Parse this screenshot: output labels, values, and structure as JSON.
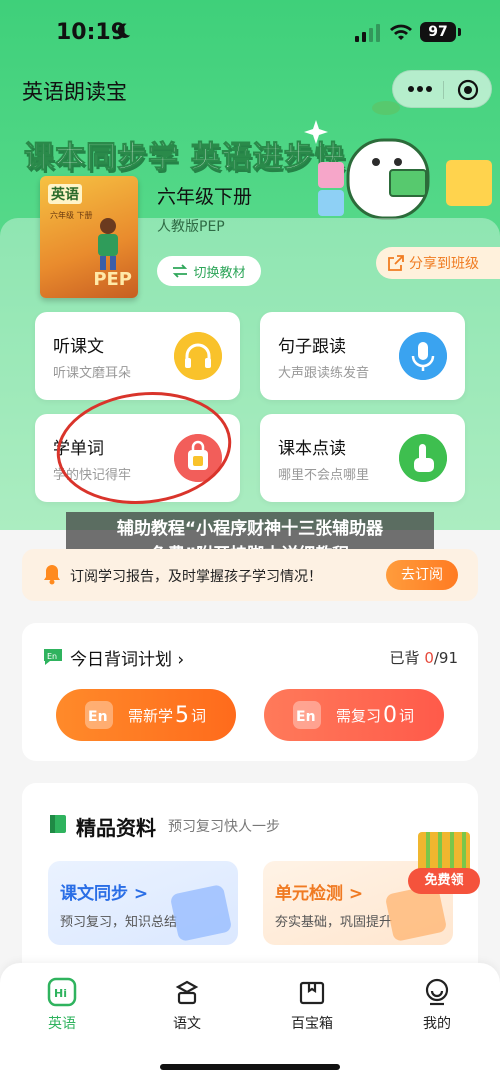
{
  "status": {
    "time": "10:19",
    "battery": "97"
  },
  "header": {
    "app_title": "英语朗读宝"
  },
  "banner": {
    "slogan": "课本同步学 英语进步快"
  },
  "book": {
    "cover_title": "英语",
    "cover_grade": "六年级 下册",
    "cover_logo": "PEP",
    "grade": "六年级下册",
    "edition": "人教版PEP",
    "switch_label": "切换教材",
    "share_label": "分享到班级"
  },
  "features": [
    {
      "title": "听课文",
      "subtitle": "听课文磨耳朵"
    },
    {
      "title": "句子跟读",
      "subtitle": "大声跟读练发音"
    },
    {
      "title": "学单词",
      "subtitle": "学的快记得牢"
    },
    {
      "title": "课本点读",
      "subtitle": "哪里不会点哪里"
    }
  ],
  "watermark": {
    "line1": "辅助教程“小程序财神十三张辅助器",
    "line2": "免费”附开挂脚本详细教程"
  },
  "notice": {
    "text": "订阅学习报告，及时掌握孩子学习情况！",
    "button": "去订阅"
  },
  "plan": {
    "title": "今日背词计划",
    "count_label": "已背",
    "count_done": "0",
    "count_total": "/91",
    "new_prefix": "需新学",
    "new_num": "5",
    "new_unit": "词",
    "review_prefix": "需复习",
    "review_num": "0",
    "review_unit": "词"
  },
  "resources": {
    "title": "精品资料",
    "subtitle": "预习复习快人一步",
    "cards": [
      {
        "title": "课文同步 >",
        "subtitle": "预习复习，知识总结"
      },
      {
        "title": "单元检测 >",
        "subtitle": "夯实基础，巩固提升"
      }
    ],
    "free_label": "免费领"
  },
  "tabs": [
    {
      "label": "英语"
    },
    {
      "label": "语文"
    },
    {
      "label": "百宝箱"
    },
    {
      "label": "我的"
    }
  ],
  "colors": {
    "brand_green": "#3fd07a",
    "accent_orange": "#ff7b22",
    "alert_red": "#e64a3c"
  }
}
